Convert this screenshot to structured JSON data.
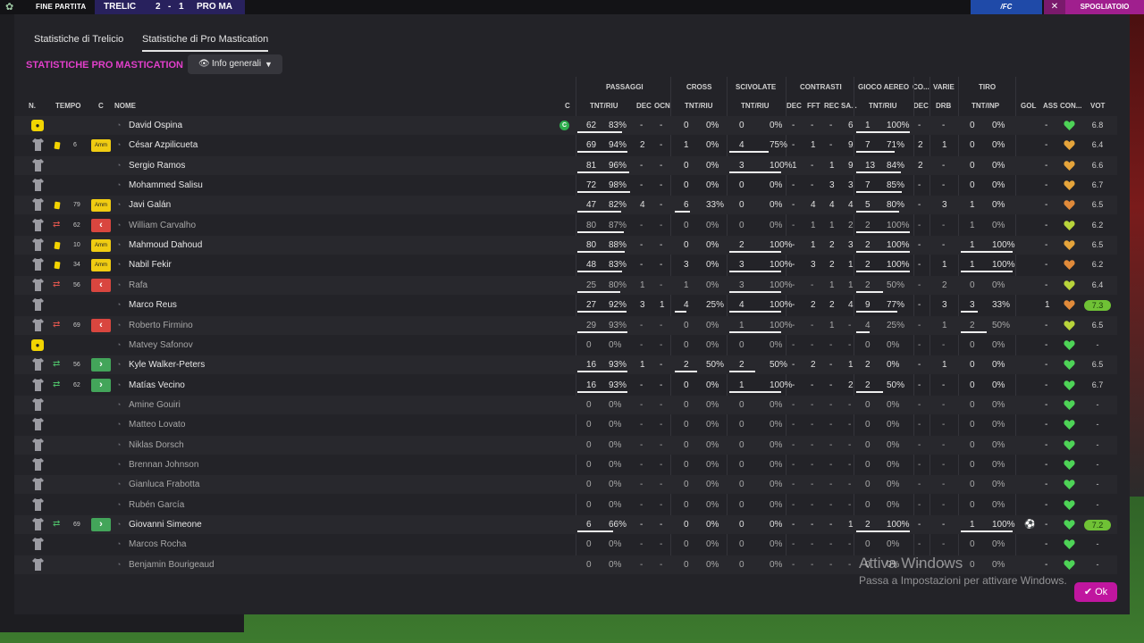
{
  "topbar": {
    "status": "FINE PARTITA",
    "home": "TRELIC",
    "score_home": "2",
    "score_sep": "-",
    "score_away": "1",
    "away": "PRO MA",
    "right_text": "/FC",
    "right_button": "SPOGLIATOIO",
    "close_glyph": "✕"
  },
  "tabs": [
    "Statistiche di Trelicio",
    "Statistiche di Pro Mastication"
  ],
  "active_tab": 1,
  "title": "STATISTICHE PRO MASTICATION",
  "view_dropdown": "Info generali",
  "headers": {
    "n": "N.",
    "tempo": "TEMPO",
    "c": "C",
    "nome": "NOME",
    "cap": "C",
    "passaggi": "PASSAGGI",
    "cross": "CROSS",
    "scivolate": "SCIVOLATE",
    "contrasti": "CONTRASTI",
    "gioco_aereo": "GIOCO AEREO",
    "co": "CO...",
    "varie": "VARIE",
    "tiro": "TIRO",
    "tnt_riu": "TNT/RIU",
    "dec": "DEC",
    "ocn": "OCN",
    "fft": "FFT",
    "rec": "REC",
    "sa": "SA...",
    "drb": "DRB",
    "tnt_inp": "TNT/INP",
    "gol": "GOL",
    "ass": "ASS",
    "con": "CON...",
    "vot": "VOT"
  },
  "players": [
    {
      "name": "David Ospina",
      "gk": true,
      "capt": true,
      "card": "",
      "sub": "",
      "min": "",
      "badge": "",
      "pas": [
        "62",
        "83%"
      ],
      "pas_dec": "-",
      "pas_ocn": "-",
      "crs": [
        "0",
        "0%"
      ],
      "sci": [
        "0",
        "0%"
      ],
      "con_dec": "-",
      "con_fft": "-",
      "con_rec": "-",
      "con_sa": "6",
      "ga": [
        "1",
        "100%"
      ],
      "co_dec": "-",
      "drb": "-",
      "tiro": [
        "0",
        "0%"
      ],
      "gol": "",
      "ass": "-",
      "con_color": "#4ed357",
      "vot": "6.8"
    },
    {
      "name": "César Azpilicueta",
      "card": "yellow",
      "min": "6",
      "badge": "amm",
      "pas": [
        "69",
        "94%"
      ],
      "pas_dec": "2",
      "pas_ocn": "-",
      "crs": [
        "1",
        "0%"
      ],
      "sci": [
        "4",
        "75%"
      ],
      "con_dec": "-",
      "con_fft": "1",
      "con_rec": "-",
      "con_sa": "9",
      "ga": [
        "7",
        "71%"
      ],
      "co_dec": "2",
      "drb": "1",
      "tiro": [
        "0",
        "0%"
      ],
      "ass": "-",
      "con_color": "#e5a43b",
      "vot": "6.4"
    },
    {
      "name": "Sergio Ramos",
      "pas": [
        "81",
        "96%"
      ],
      "pas_dec": "-",
      "pas_ocn": "-",
      "crs": [
        "0",
        "0%"
      ],
      "sci": [
        "3",
        "100%"
      ],
      "con_dec": "1",
      "con_fft": "-",
      "con_rec": "1",
      "con_sa": "9",
      "ga": [
        "13",
        "84%"
      ],
      "co_dec": "2",
      "drb": "-",
      "tiro": [
        "0",
        "0%"
      ],
      "ass": "-",
      "con_color": "#e5a43b",
      "vot": "6.6"
    },
    {
      "name": "Mohammed Salisu",
      "pas": [
        "72",
        "98%"
      ],
      "pas_dec": "-",
      "pas_ocn": "-",
      "crs": [
        "0",
        "0%"
      ],
      "sci": [
        "0",
        "0%"
      ],
      "con_dec": "-",
      "con_fft": "-",
      "con_rec": "3",
      "con_sa": "3",
      "ga": [
        "7",
        "85%"
      ],
      "co_dec": "-",
      "drb": "-",
      "tiro": [
        "0",
        "0%"
      ],
      "ass": "-",
      "con_color": "#e5a43b",
      "vot": "6.7"
    },
    {
      "name": "Javi Galán",
      "card": "yellow",
      "min": "79",
      "badge": "amm",
      "pas": [
        "47",
        "82%"
      ],
      "pas_dec": "4",
      "pas_ocn": "-",
      "crs": [
        "6",
        "33%"
      ],
      "sci": [
        "0",
        "0%"
      ],
      "con_dec": "-",
      "con_fft": "4",
      "con_rec": "4",
      "con_sa": "4",
      "ga": [
        "5",
        "80%"
      ],
      "co_dec": "-",
      "drb": "3",
      "tiro": [
        "1",
        "0%"
      ],
      "ass": "-",
      "con_color": "#e08a3a",
      "vot": "6.5"
    },
    {
      "name": "William Carvalho",
      "dim": true,
      "sub": "out",
      "min": "62",
      "badge": "out",
      "pas": [
        "80",
        "87%"
      ],
      "pas_dec": "-",
      "pas_ocn": "-",
      "crs": [
        "0",
        "0%"
      ],
      "sci": [
        "0",
        "0%"
      ],
      "con_dec": "-",
      "con_fft": "1",
      "con_rec": "1",
      "con_sa": "2",
      "ga": [
        "2",
        "100%"
      ],
      "co_dec": "-",
      "drb": "-",
      "tiro": [
        "1",
        "0%"
      ],
      "ass": "-",
      "con_color": "#b8d43b",
      "vot": "6.2"
    },
    {
      "name": "Mahmoud Dahoud",
      "card": "yellow",
      "min": "10",
      "badge": "amm",
      "pas": [
        "80",
        "88%"
      ],
      "pas_dec": "-",
      "pas_ocn": "-",
      "crs": [
        "0",
        "0%"
      ],
      "sci": [
        "2",
        "100%"
      ],
      "con_dec": "-",
      "con_fft": "1",
      "con_rec": "2",
      "con_sa": "3",
      "ga": [
        "2",
        "100%"
      ],
      "co_dec": "-",
      "drb": "-",
      "tiro": [
        "1",
        "100%"
      ],
      "ass": "-",
      "con_color": "#e5a43b",
      "vot": "6.5"
    },
    {
      "name": "Nabil Fekir",
      "card": "yellow",
      "min": "34",
      "badge": "amm",
      "pas": [
        "48",
        "83%"
      ],
      "pas_dec": "-",
      "pas_ocn": "-",
      "crs": [
        "3",
        "0%"
      ],
      "sci": [
        "3",
        "100%"
      ],
      "con_dec": "-",
      "con_fft": "3",
      "con_rec": "2",
      "con_sa": "1",
      "ga": [
        "2",
        "100%"
      ],
      "co_dec": "-",
      "drb": "1",
      "tiro": [
        "1",
        "100%"
      ],
      "ass": "-",
      "con_color": "#e08a3a",
      "vot": "6.2"
    },
    {
      "name": "Rafa",
      "dim": true,
      "sub": "out",
      "min": "56",
      "badge": "out",
      "pas": [
        "25",
        "80%"
      ],
      "pas_dec": "1",
      "pas_ocn": "-",
      "crs": [
        "1",
        "0%"
      ],
      "sci": [
        "3",
        "100%"
      ],
      "con_dec": "-",
      "con_fft": "-",
      "con_rec": "1",
      "con_sa": "1",
      "ga": [
        "2",
        "50%"
      ],
      "co_dec": "-",
      "drb": "2",
      "tiro": [
        "0",
        "0%"
      ],
      "ass": "-",
      "con_color": "#b8d43b",
      "vot": "6.4"
    },
    {
      "name": "Marco Reus",
      "pas": [
        "27",
        "92%"
      ],
      "pas_dec": "3",
      "pas_ocn": "1",
      "crs": [
        "4",
        "25%"
      ],
      "sci": [
        "4",
        "100%"
      ],
      "con_dec": "-",
      "con_fft": "2",
      "con_rec": "2",
      "con_sa": "4",
      "ga": [
        "9",
        "77%"
      ],
      "co_dec": "-",
      "drb": "3",
      "tiro": [
        "3",
        "33%"
      ],
      "ass": "1",
      "con_color": "#e08a3a",
      "vot": "7.3",
      "vot_top": true
    },
    {
      "name": "Roberto Firmino",
      "dim": true,
      "sub": "out",
      "min": "69",
      "badge": "out",
      "pas": [
        "29",
        "93%"
      ],
      "pas_dec": "-",
      "pas_ocn": "-",
      "crs": [
        "0",
        "0%"
      ],
      "sci": [
        "1",
        "100%"
      ],
      "con_dec": "-",
      "con_fft": "-",
      "con_rec": "1",
      "con_sa": "-",
      "ga": [
        "4",
        "25%"
      ],
      "co_dec": "-",
      "drb": "1",
      "tiro": [
        "2",
        "50%"
      ],
      "ass": "-",
      "con_color": "#b8d43b",
      "vot": "6.5"
    },
    {
      "name": "Matvey Safonov",
      "dim": true,
      "gk": true,
      "pas": [
        "0",
        "0%"
      ],
      "pas_dec": "-",
      "pas_ocn": "-",
      "crs": [
        "0",
        "0%"
      ],
      "sci": [
        "0",
        "0%"
      ],
      "con_dec": "-",
      "con_fft": "-",
      "con_rec": "-",
      "con_sa": "-",
      "ga": [
        "0",
        "0%"
      ],
      "co_dec": "-",
      "drb": "-",
      "tiro": [
        "0",
        "0%"
      ],
      "ass": "-",
      "con_color": "#4ed357",
      "vot": "-"
    },
    {
      "name": "Kyle Walker-Peters",
      "sub": "in",
      "min": "56",
      "badge": "in",
      "pas": [
        "16",
        "93%"
      ],
      "pas_dec": "1",
      "pas_ocn": "-",
      "crs": [
        "2",
        "50%"
      ],
      "sci": [
        "2",
        "50%"
      ],
      "con_dec": "-",
      "con_fft": "2",
      "con_rec": "-",
      "con_sa": "1",
      "ga": [
        "2",
        "0%"
      ],
      "co_dec": "-",
      "drb": "1",
      "tiro": [
        "0",
        "0%"
      ],
      "ass": "-",
      "con_color": "#4ed357",
      "vot": "6.5"
    },
    {
      "name": "Matías Vecino",
      "sub": "in",
      "min": "62",
      "badge": "in",
      "pas": [
        "16",
        "93%"
      ],
      "pas_dec": "-",
      "pas_ocn": "-",
      "crs": [
        "0",
        "0%"
      ],
      "sci": [
        "1",
        "100%"
      ],
      "con_dec": "-",
      "con_fft": "-",
      "con_rec": "-",
      "con_sa": "2",
      "ga": [
        "2",
        "50%"
      ],
      "co_dec": "-",
      "drb": "-",
      "tiro": [
        "0",
        "0%"
      ],
      "ass": "-",
      "con_color": "#4ed357",
      "vot": "6.7"
    },
    {
      "name": "Amine Gouiri",
      "dim": true,
      "pas": [
        "0",
        "0%"
      ],
      "pas_dec": "-",
      "pas_ocn": "-",
      "crs": [
        "0",
        "0%"
      ],
      "sci": [
        "0",
        "0%"
      ],
      "con_dec": "-",
      "con_fft": "-",
      "con_rec": "-",
      "con_sa": "-",
      "ga": [
        "0",
        "0%"
      ],
      "co_dec": "-",
      "drb": "-",
      "tiro": [
        "0",
        "0%"
      ],
      "ass": "-",
      "con_color": "#4ed357",
      "vot": "-"
    },
    {
      "name": "Matteo Lovato",
      "dim": true,
      "pas": [
        "0",
        "0%"
      ],
      "pas_dec": "-",
      "pas_ocn": "-",
      "crs": [
        "0",
        "0%"
      ],
      "sci": [
        "0",
        "0%"
      ],
      "con_dec": "-",
      "con_fft": "-",
      "con_rec": "-",
      "con_sa": "-",
      "ga": [
        "0",
        "0%"
      ],
      "co_dec": "-",
      "drb": "-",
      "tiro": [
        "0",
        "0%"
      ],
      "ass": "-",
      "con_color": "#4ed357",
      "vot": "-"
    },
    {
      "name": "Niklas Dorsch",
      "dim": true,
      "pas": [
        "0",
        "0%"
      ],
      "pas_dec": "-",
      "pas_ocn": "-",
      "crs": [
        "0",
        "0%"
      ],
      "sci": [
        "0",
        "0%"
      ],
      "con_dec": "-",
      "con_fft": "-",
      "con_rec": "-",
      "con_sa": "-",
      "ga": [
        "0",
        "0%"
      ],
      "co_dec": "-",
      "drb": "-",
      "tiro": [
        "0",
        "0%"
      ],
      "ass": "-",
      "con_color": "#4ed357",
      "vot": "-"
    },
    {
      "name": "Brennan Johnson",
      "dim": true,
      "pas": [
        "0",
        "0%"
      ],
      "pas_dec": "-",
      "pas_ocn": "-",
      "crs": [
        "0",
        "0%"
      ],
      "sci": [
        "0",
        "0%"
      ],
      "con_dec": "-",
      "con_fft": "-",
      "con_rec": "-",
      "con_sa": "-",
      "ga": [
        "0",
        "0%"
      ],
      "co_dec": "-",
      "drb": "-",
      "tiro": [
        "0",
        "0%"
      ],
      "ass": "-",
      "con_color": "#4ed357",
      "vot": "-"
    },
    {
      "name": "Gianluca Frabotta",
      "dim": true,
      "pas": [
        "0",
        "0%"
      ],
      "pas_dec": "-",
      "pas_ocn": "-",
      "crs": [
        "0",
        "0%"
      ],
      "sci": [
        "0",
        "0%"
      ],
      "con_dec": "-",
      "con_fft": "-",
      "con_rec": "-",
      "con_sa": "-",
      "ga": [
        "0",
        "0%"
      ],
      "co_dec": "-",
      "drb": "-",
      "tiro": [
        "0",
        "0%"
      ],
      "ass": "-",
      "con_color": "#4ed357",
      "vot": "-"
    },
    {
      "name": "Rubén García",
      "dim": true,
      "pas": [
        "0",
        "0%"
      ],
      "pas_dec": "-",
      "pas_ocn": "-",
      "crs": [
        "0",
        "0%"
      ],
      "sci": [
        "0",
        "0%"
      ],
      "con_dec": "-",
      "con_fft": "-",
      "con_rec": "-",
      "con_sa": "-",
      "ga": [
        "0",
        "0%"
      ],
      "co_dec": "-",
      "drb": "-",
      "tiro": [
        "0",
        "0%"
      ],
      "ass": "-",
      "con_color": "#4ed357",
      "vot": "-"
    },
    {
      "name": "Giovanni Simeone",
      "sub": "in",
      "min": "69",
      "badge": "in",
      "pas": [
        "6",
        "66%"
      ],
      "pas_dec": "-",
      "pas_ocn": "-",
      "crs": [
        "0",
        "0%"
      ],
      "sci": [
        "0",
        "0%"
      ],
      "con_dec": "-",
      "con_fft": "-",
      "con_rec": "-",
      "con_sa": "1",
      "ga": [
        "2",
        "100%"
      ],
      "co_dec": "-",
      "drb": "-",
      "tiro": [
        "1",
        "100%"
      ],
      "goal": true,
      "ass": "-",
      "con_color": "#4ed357",
      "vot": "7.2",
      "vot_top": true
    },
    {
      "name": "Marcos Rocha",
      "dim": true,
      "pas": [
        "0",
        "0%"
      ],
      "pas_dec": "-",
      "pas_ocn": "-",
      "crs": [
        "0",
        "0%"
      ],
      "sci": [
        "0",
        "0%"
      ],
      "con_dec": "-",
      "con_fft": "-",
      "con_rec": "-",
      "con_sa": "-",
      "ga": [
        "0",
        "0%"
      ],
      "co_dec": "-",
      "drb": "-",
      "tiro": [
        "0",
        "0%"
      ],
      "ass": "-",
      "con_color": "#4ed357",
      "vot": "-"
    },
    {
      "name": "Benjamin Bourigeaud",
      "dim": true,
      "pas": [
        "0",
        "0%"
      ],
      "pas_dec": "-",
      "pas_ocn": "-",
      "crs": [
        "0",
        "0%"
      ],
      "sci": [
        "0",
        "0%"
      ],
      "con_dec": "-",
      "con_fft": "-",
      "con_rec": "-",
      "con_sa": "-",
      "ga": [
        "0",
        "0%"
      ],
      "co_dec": "-",
      "drb": "-",
      "tiro": [
        "0",
        "0%"
      ],
      "ass": "-",
      "con_color": "#4ed357",
      "vot": "-"
    }
  ],
  "badge_labels": {
    "amm": "Amm",
    "out": "‹",
    "in": "›",
    "gk": "●",
    "capt": "C"
  },
  "watermark": {
    "line1": "Attiva Windows",
    "line2": "Passa a Impostazioni per attivare Windows."
  },
  "ok_label": "Ok"
}
